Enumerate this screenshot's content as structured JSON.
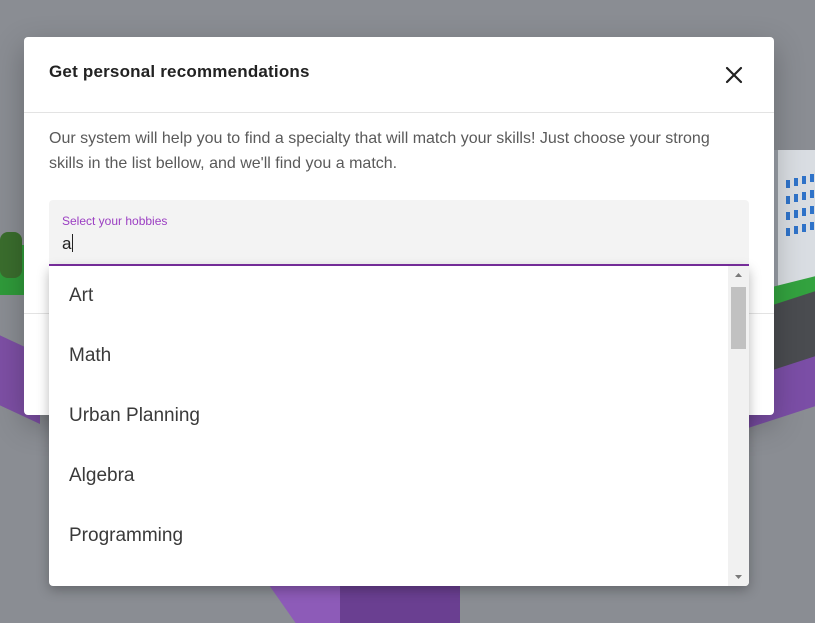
{
  "dialog": {
    "title": "Get personal recommendations",
    "description": "Our system will help you to find a specialty that will match your skills! Just choose your strong skills in the list bellow, and we'll find you a match."
  },
  "hobbies_field": {
    "label": "Select your hobbies",
    "value": "a"
  },
  "dropdown": {
    "options": [
      {
        "label": "Art"
      },
      {
        "label": "Math"
      },
      {
        "label": "Urban Planning"
      },
      {
        "label": "Algebra"
      },
      {
        "label": "Programming"
      }
    ]
  },
  "colors": {
    "accent": "#7b2fa0",
    "label_accent": "#9b3ec2",
    "backdrop": "#8a8d93"
  },
  "icons": {
    "close": "close-icon",
    "scroll_up": "triangle-up-icon",
    "scroll_down": "triangle-down-icon"
  }
}
